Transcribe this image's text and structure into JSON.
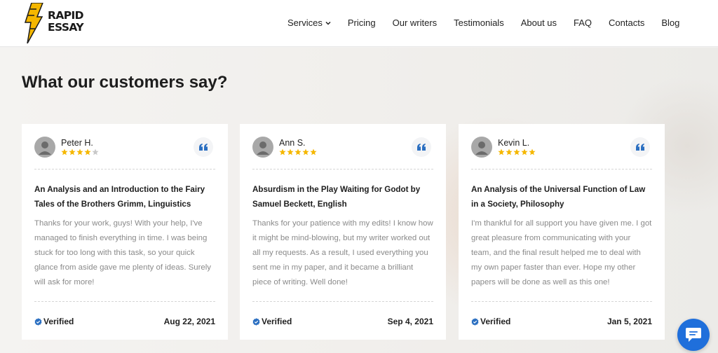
{
  "brand": {
    "line1": "RAPID",
    "line2": "ESSAY",
    "accent": "#f5b700"
  },
  "nav": [
    {
      "label": "Services",
      "has_dropdown": true
    },
    {
      "label": "Pricing"
    },
    {
      "label": "Our writers"
    },
    {
      "label": "Testimonials"
    },
    {
      "label": "About us"
    },
    {
      "label": "FAQ"
    },
    {
      "label": "Contacts"
    },
    {
      "label": "Blog"
    }
  ],
  "section": {
    "title": "What our customers say?"
  },
  "reviews": [
    {
      "name": "Peter H.",
      "rating": 4,
      "title": "An Analysis and an Introduction to the Fairy Tales of the Brothers Grimm, Linguistics",
      "text": "Thanks for your work, guys! With your help, I've managed to finish everything in time. I was being stuck for too long with this task, so your quick glance from aside gave me plenty of ideas. Surely will ask for more!",
      "verified": "Verified",
      "date": "Aug 22, 2021"
    },
    {
      "name": "Ann S.",
      "rating": 5,
      "title": "Absurdism in the Play Waiting for Godot by Samuel Beckett, English",
      "text": "Thanks for your patience with my edits! I know how it might be mind-blowing, but my writer worked out all my requests. As a result, I used everything you sent me in my paper, and it became a brilliant piece of writing. Well done!",
      "verified": "Verified",
      "date": "Sep 4, 2021"
    },
    {
      "name": "Kevin L.",
      "rating": 5,
      "title": "An Analysis of the Universal Function of Law in a Society, Philosophy",
      "text": "I'm thankful for all support you have given me. I got great pleasure from communicating with your team, and the final result helped me to deal with my own paper faster than ever. Hope my other papers will be done as well as this one!",
      "verified": "Verified",
      "date": "Jan 5, 2021"
    }
  ],
  "colors": {
    "star": "#f5b700",
    "star_empty": "#c8c8c8",
    "quote": "#2b6fc1",
    "verified": "#2b6fc1",
    "chat": "#1f6fdb"
  },
  "icons": {
    "quote": "quote-icon",
    "verified": "verified-check-icon",
    "chat": "chat-icon",
    "avatar": "user-avatar-icon"
  }
}
